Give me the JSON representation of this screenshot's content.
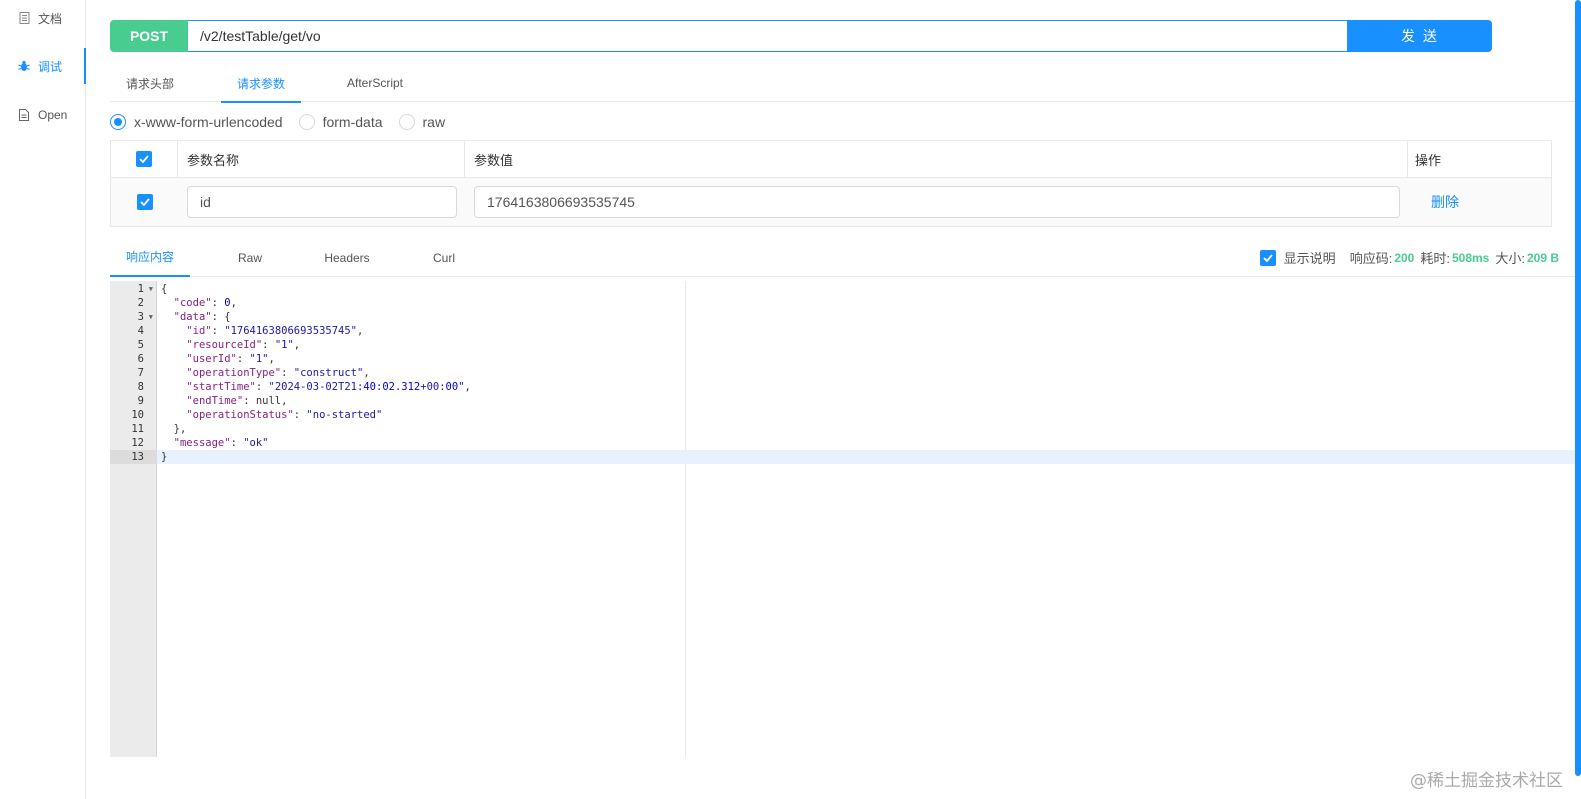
{
  "sidebar": {
    "items": [
      {
        "label": "文档",
        "icon": "document-icon"
      },
      {
        "label": "调试",
        "icon": "bug-icon"
      },
      {
        "label": "Open",
        "icon": "file-icon"
      }
    ]
  },
  "request": {
    "method": "POST",
    "url": "/v2/testTable/get/vo",
    "send_label": "发 送"
  },
  "request_tabs": [
    "请求头部",
    "请求参数",
    "AfterScript"
  ],
  "body_types": [
    "x-www-form-urlencoded",
    "form-data",
    "raw"
  ],
  "params": {
    "headers": {
      "name": "参数名称",
      "value": "参数值",
      "action": "操作"
    },
    "rows": [
      {
        "name": "id",
        "value": "1764163806693535745",
        "action": "删除"
      }
    ]
  },
  "response_tabs": [
    "响应内容",
    "Raw",
    "Headers",
    "Curl"
  ],
  "response_info": {
    "show_desc": "显示说明",
    "code_label": "响应码:",
    "code": "200",
    "time_label": "耗时:",
    "time": "508ms",
    "size_label": "大小:",
    "size": "209 B"
  },
  "response_lines": [
    "{",
    "  \"code\": 0,",
    "  \"data\": {",
    "    \"id\": \"1764163806693535745\",",
    "    \"resourceId\": \"1\",",
    "    \"userId\": \"1\",",
    "    \"operationType\": \"construct\",",
    "    \"startTime\": \"2024-03-02T21:40:02.312+00:00\",",
    "    \"endTime\": null,",
    "    \"operationStatus\": \"no-started\"",
    "  },",
    "  \"message\": \"ok\"",
    "}"
  ],
  "line_numbers": [
    "1",
    "2",
    "3",
    "4",
    "5",
    "6",
    "7",
    "8",
    "9",
    "10",
    "11",
    "12",
    "13"
  ],
  "watermark": "@稀土掘金技术社区",
  "colors": {
    "accent": "#1890ff",
    "method": "#49cc90"
  }
}
